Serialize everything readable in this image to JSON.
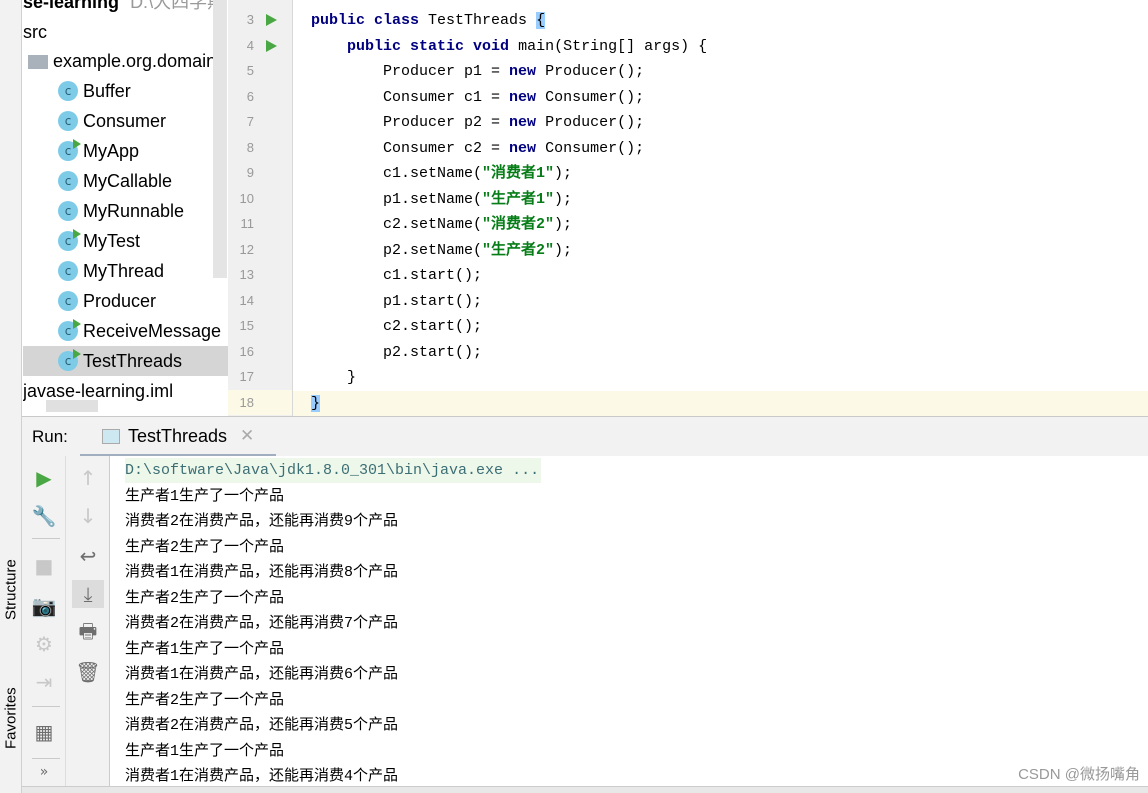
{
  "project": {
    "title": "ase-learning",
    "path": "D:\\大四学期",
    "src": "src",
    "package": "example.org.domain",
    "classes": [
      {
        "name": "Buffer",
        "runnable": false
      },
      {
        "name": "Consumer",
        "runnable": false
      },
      {
        "name": "MyApp",
        "runnable": true
      },
      {
        "name": "MyCallable",
        "runnable": false
      },
      {
        "name": "MyRunnable",
        "runnable": false
      },
      {
        "name": "MyTest",
        "runnable": true
      },
      {
        "name": "MyThread",
        "runnable": false
      },
      {
        "name": "Producer",
        "runnable": false
      },
      {
        "name": "ReceiveMessage",
        "runnable": true
      },
      {
        "name": "TestThreads",
        "runnable": true,
        "selected": true
      }
    ],
    "iml": "javase-learning.iml"
  },
  "side_tabs": {
    "structure": "Structure",
    "favorites": "Favorites"
  },
  "editor": {
    "lines": [
      {
        "n": "3",
        "run": true,
        "tokens": [
          [
            "public ",
            "kw"
          ],
          [
            "class ",
            "kw"
          ],
          [
            "TestThreads ",
            ""
          ],
          [
            "{",
            "brace"
          ]
        ]
      },
      {
        "n": "4",
        "run": true,
        "tokens": [
          [
            "    public ",
            "kw"
          ],
          [
            "static ",
            "kw"
          ],
          [
            "void ",
            "kw"
          ],
          [
            "main(String[] args) {",
            ""
          ]
        ]
      },
      {
        "n": "5",
        "tokens": [
          [
            "        Producer p1 = ",
            ""
          ],
          [
            "new ",
            "kw"
          ],
          [
            "Producer();",
            ""
          ]
        ]
      },
      {
        "n": "6",
        "tokens": [
          [
            "        Consumer c1 = ",
            ""
          ],
          [
            "new ",
            "kw"
          ],
          [
            "Consumer();",
            ""
          ]
        ]
      },
      {
        "n": "7",
        "tokens": [
          [
            "        Producer p2 = ",
            ""
          ],
          [
            "new ",
            "kw"
          ],
          [
            "Producer();",
            ""
          ]
        ]
      },
      {
        "n": "8",
        "tokens": [
          [
            "        Consumer c2 = ",
            ""
          ],
          [
            "new ",
            "kw"
          ],
          [
            "Consumer();",
            ""
          ]
        ]
      },
      {
        "n": "9",
        "tokens": [
          [
            "        c1.setName(",
            ""
          ],
          [
            "\"消费者1\"",
            "str"
          ],
          [
            ");",
            ""
          ]
        ]
      },
      {
        "n": "10",
        "tokens": [
          [
            "        p1.setName(",
            ""
          ],
          [
            "\"生产者1\"",
            "str"
          ],
          [
            ");",
            ""
          ]
        ]
      },
      {
        "n": "11",
        "tokens": [
          [
            "        c2.setName(",
            ""
          ],
          [
            "\"消费者2\"",
            "str"
          ],
          [
            ");",
            ""
          ]
        ]
      },
      {
        "n": "12",
        "tokens": [
          [
            "        p2.setName(",
            ""
          ],
          [
            "\"生产者2\"",
            "str"
          ],
          [
            ");",
            ""
          ]
        ]
      },
      {
        "n": "13",
        "tokens": [
          [
            "        c1.start();",
            ""
          ]
        ]
      },
      {
        "n": "14",
        "tokens": [
          [
            "        p1.start();",
            ""
          ]
        ]
      },
      {
        "n": "15",
        "tokens": [
          [
            "        c2.start();",
            ""
          ]
        ]
      },
      {
        "n": "16",
        "tokens": [
          [
            "        p2.start();",
            ""
          ]
        ]
      },
      {
        "n": "17",
        "tokens": [
          [
            "    }",
            ""
          ]
        ]
      },
      {
        "n": "18",
        "current": true,
        "tokens": [
          [
            "}",
            "brace"
          ]
        ]
      }
    ]
  },
  "run": {
    "label": "Run:",
    "tab": "TestThreads",
    "command": "D:\\software\\Java\\jdk1.8.0_301\\bin\\java.exe ...",
    "output": [
      "生产者1生产了一个产品",
      "消费者2在消费产品，还能再消费9个产品",
      "生产者2生产了一个产品",
      "消费者1在消费产品，还能再消费8个产品",
      "生产者2生产了一个产品",
      "消费者2在消费产品，还能再消费7个产品",
      "生产者1生产了一个产品",
      "消费者1在消费产品，还能再消费6个产品",
      "生产者2生产了一个产品",
      "消费者2在消费产品，还能再消费5个产品",
      "生产者1生产了一个产品",
      "消费者1在消费产品，还能再消费4个产品"
    ]
  },
  "watermark": "CSDN @微扬嘴角"
}
